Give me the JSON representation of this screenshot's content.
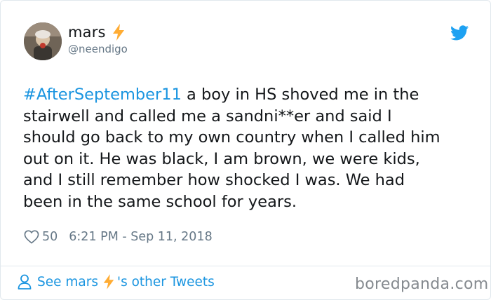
{
  "tweet": {
    "author_name": "mars",
    "author_handle": "@neendigo",
    "hashtag": "#AfterSeptember11",
    "body": " a boy in HS shoved me in the\nstairwell and called me a sandni**er and said I\nshould go back to my own country when I called him\nout on it. He was black, I am brown, we were kids,\nand I still remember how shocked I was. We had\nbeen in the same school for years.",
    "like_count": "50",
    "timestamp": "6:21 PM - Sep 11, 2018"
  },
  "footer": {
    "see_prefix": "See mars",
    "see_suffix": "'s other Tweets"
  },
  "watermark": "boredpanda.com",
  "icons": {
    "verified_emoji": "lightning-bolt-icon",
    "brand": "twitter-bird-icon",
    "like": "heart-icon",
    "profile": "person-icon"
  },
  "colors": {
    "link_blue": "#1b95e0",
    "muted_gray": "#657786",
    "bolt_yellow": "#ffac33",
    "border": "#e1e8ed"
  }
}
